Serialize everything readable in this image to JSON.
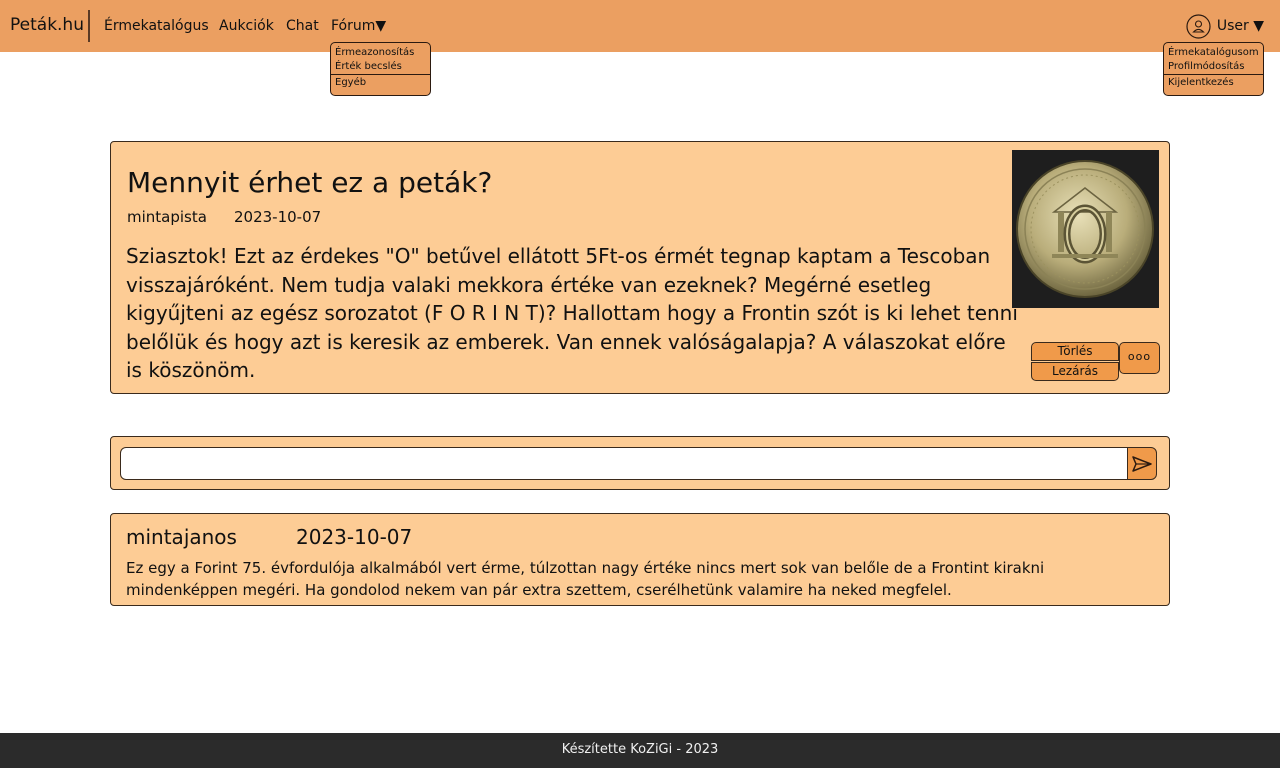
{
  "navbar": {
    "brand": "Peták.hu",
    "links": {
      "catalog": "Érmekatalógus",
      "auctions": "Aukciók",
      "chat": "Chat",
      "forum": "Fórum▼"
    },
    "user_label": "User ▼",
    "colors": {
      "background": "#eb9f61"
    }
  },
  "forum_dropdown": {
    "items": [
      "Érmeazonosítás",
      "Érték becslés",
      "Egyéb"
    ]
  },
  "user_dropdown": {
    "items": [
      "Érmekatalógusom",
      "Profilmódosítás",
      "Kijelentkezés"
    ]
  },
  "post": {
    "title": "Mennyit érhet ez a peták?",
    "author": "mintapista",
    "date": "2023-10-07",
    "body": "Sziasztok! Ezt az érdekes \"O\" betűvel ellátott 5Ft-os érmét tegnap kaptam a Tescoban visszajáróként. Nem tudja valaki mekkora értéke van ezeknek? Megérné esetleg kigyűjteni az egész sorozatot (F O R I N T)? Hallottam hogy a Frontin szót is ki lehet tenni belőlük és hogy azt is keresik az emberek. Van ennek valóságalapja? A válaszokat előre is köszönöm.",
    "delete_label": "Törlés",
    "close_label": "Lezárás",
    "more_label": "ooo",
    "image_icon": "coin-photo",
    "colors": {
      "card": "#fdcc95",
      "button": "#f09a4a"
    }
  },
  "reply": {
    "value": "",
    "placeholder": "",
    "send_icon": "send-arrow-icon"
  },
  "comments": [
    {
      "author": "mintajanos",
      "date": "2023-10-07",
      "body": "Ez egy a Forint 75. évfordulója alkalmából vert érme, túlzottan nagy értéke nincs mert sok van belőle de a Frontint kirakni mindenképpen megéri. Ha gondolod nekem van pár extra szettem, cserélhetünk valamire ha neked megfelel."
    }
  ],
  "footer": {
    "text": "Készítette KoZiGi - 2023",
    "colors": {
      "background": "#2b2b2b"
    }
  }
}
